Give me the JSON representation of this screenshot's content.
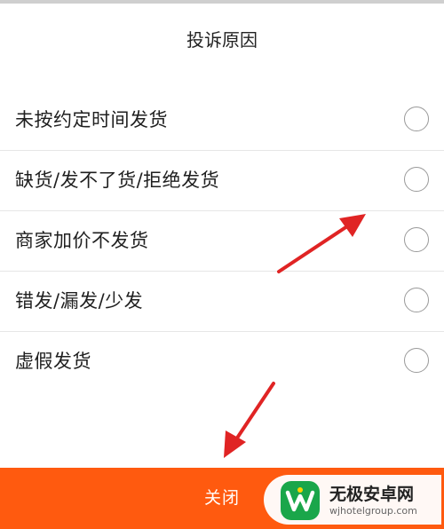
{
  "sheet": {
    "title": "投诉原因"
  },
  "options": [
    {
      "label": "未按约定时间发货",
      "selected": false
    },
    {
      "label": "缺货/发不了货/拒绝发货",
      "selected": false
    },
    {
      "label": "商家加价不发货",
      "selected": false
    },
    {
      "label": "错发/漏发/少发",
      "selected": false
    },
    {
      "label": "虚假发货",
      "selected": false
    }
  ],
  "footer": {
    "close_label": "关闭"
  },
  "watermark": {
    "title": "无极安卓网",
    "url": "wjhotelgroup.com"
  },
  "colors": {
    "accent": "#ff5a0f",
    "annotation_arrow": "#e02424",
    "logo_green": "#1aa64a"
  }
}
